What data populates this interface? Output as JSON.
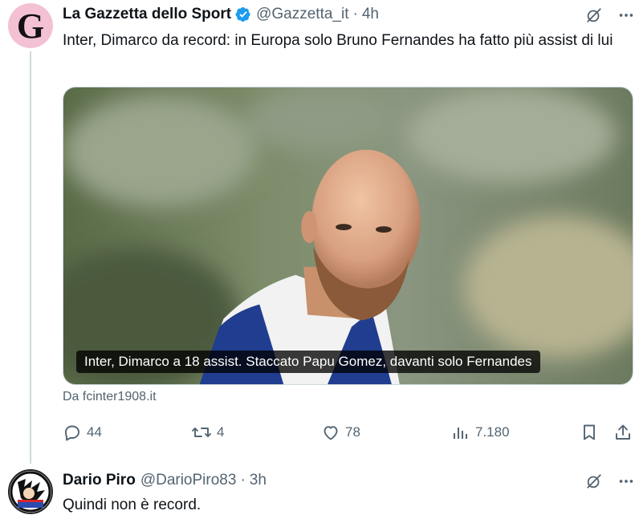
{
  "tweet": {
    "author_name": "La Gazzetta dello Sport",
    "avatar_letter": "G",
    "handle": "@Gazzetta_it",
    "separator": "·",
    "time": "4h",
    "text": "Inter, Dimarco da record: in Europa solo Bruno Fernandes ha fatto più assist di lui",
    "media_caption": "Inter, Dimarco a 18 assist. Staccato Papu Gomez, davanti solo Fernandes",
    "source": "Da fcinter1908.it",
    "replies": "44",
    "retweets": "4",
    "likes": "78",
    "views": "7.180",
    "accent_color": "#1d9bf0"
  },
  "reply": {
    "author_name": "Dario Piro",
    "handle": "@DarioPiro83",
    "separator": "·",
    "time": "3h",
    "text": "Quindi non è record."
  },
  "icons": {
    "verified": "verified-badge-icon",
    "grok": "grok-icon",
    "more": "more-icon",
    "reply": "reply-icon",
    "retweet": "retweet-icon",
    "like": "like-icon",
    "views": "views-icon",
    "bookmark": "bookmark-icon",
    "share": "share-icon"
  }
}
